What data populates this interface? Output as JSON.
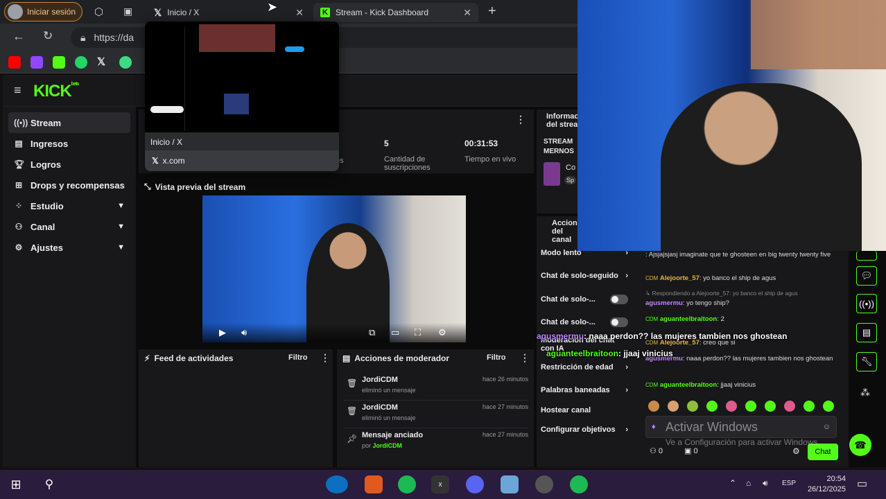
{
  "browser": {
    "profile_label": "Iniciar sesión",
    "tabs": [
      {
        "title": "Inicio / X",
        "icon": "x-logo-icon"
      },
      {
        "title": "Stream - Kick Dashboard",
        "icon": "kick-logo-icon"
      }
    ],
    "new_tab": "+",
    "url_text": "https://da",
    "tab_preview": {
      "title": "Inicio / X",
      "domain": "x.com"
    }
  },
  "kick": {
    "logo": "KICK",
    "beta": "beta",
    "sidebar": [
      {
        "label": "Stream",
        "icon": "broadcast-icon",
        "active": true
      },
      {
        "label": "Ingresos",
        "icon": "wallet-icon"
      },
      {
        "label": "Logros",
        "icon": "trophy-icon"
      },
      {
        "label": "Drops y recompensas",
        "icon": "gift-icon"
      },
      {
        "label": "Estudio",
        "icon": "studio-icon",
        "chevron": true
      },
      {
        "label": "Canal",
        "icon": "channel-icon",
        "chevron": true
      },
      {
        "label": "Ajustes",
        "icon": "gear-icon",
        "chevron": true
      }
    ],
    "stats": [
      {
        "value": "5",
        "label": "Cantidad de suscripciones"
      },
      {
        "value": "00:31:53",
        "label": "Tiempo en vivo"
      }
    ],
    "stats_partial_label": "es",
    "stream_info_title": "Información del stream",
    "stream_info_text": "STREAM MERNOS",
    "stream_info_category": "Co",
    "stream_info_tag": "Sp",
    "preview_title": "Vista previa del stream",
    "feed_title": "Feed de actividades",
    "filter_label": "Filtro",
    "mod_actions_title": "Acciones de moderador",
    "mod_actions": [
      {
        "name": "JordiCDM",
        "action": "eliminó un mensaje",
        "time": "hace 26 minutos",
        "icon": "trash-icon"
      },
      {
        "name": "JordiCDM",
        "action": "eliminó un mensaje",
        "time": "hace 27 minutos",
        "icon": "trash-icon"
      },
      {
        "name": "Mensaje anciado",
        "action": "por",
        "by": "JordiCDM",
        "time": "hace 27 minutos",
        "icon": "pin-icon"
      }
    ],
    "channel_actions_title": "Acciones del canal",
    "channel_settings": [
      {
        "label": "Modo lento",
        "control": "chevron"
      },
      {
        "label": "Chat de solo-seguido",
        "control": "chevron"
      },
      {
        "label": "Chat de solo-...",
        "control": "toggle"
      },
      {
        "label": "Chat de solo-...",
        "control": "toggle"
      },
      {
        "label": "Moderación del chat con IA",
        "control": "none"
      },
      {
        "label": "Restricción de edad",
        "control": "chevron"
      },
      {
        "label": "Palabras baneadas",
        "control": "chevron"
      },
      {
        "label": "Hostear canal",
        "control": "none"
      },
      {
        "label": "Configurar objetivos",
        "control": "chevron"
      }
    ]
  },
  "chat": {
    "messages": [
      {
        "user": "",
        "text": ": Ajsjajsjasj imaginate que te ghosteen en big twenty twenty five"
      },
      {
        "user": "Alejoorte_57",
        "badge": "CDM",
        "text": ": yo banco el ship de agus"
      },
      {
        "reply": "Respondiendo a Alejoorte_57: yo banco el ship de agus"
      },
      {
        "user": "agusmermu",
        "text": ": yo tengo ship?"
      },
      {
        "user": "aguanteelbraitoon",
        "badge": "CDM",
        "text": ": 2"
      },
      {
        "user": "Alejoorte_57",
        "badge": "CDM",
        "text": ": creo que si"
      },
      {
        "user": "agusmermu",
        "text": ": naaa perdon?? las mujeres tambien nos ghostean"
      },
      {
        "user": "aguanteelbraitoon",
        "badge": "CDM",
        "text": ": jjaaj vinicius"
      }
    ],
    "overlay": [
      {
        "user": "agusmermu",
        "text": ": naaa perdon?? las mujeres tambien nos ghostean"
      },
      {
        "user": "aguanteelbraitoon",
        "text": ": jjaaj vinicius"
      }
    ],
    "input_placeholder": "Activar Windows",
    "send_label": "Chat",
    "viewers": "0",
    "subs": "0"
  },
  "windows": {
    "activate_title": "Activar Windows",
    "activate_sub": "Ve a Configuración para activar Windows.",
    "lang": "ESP",
    "time": "20:54",
    "date": "26/12/2025"
  }
}
